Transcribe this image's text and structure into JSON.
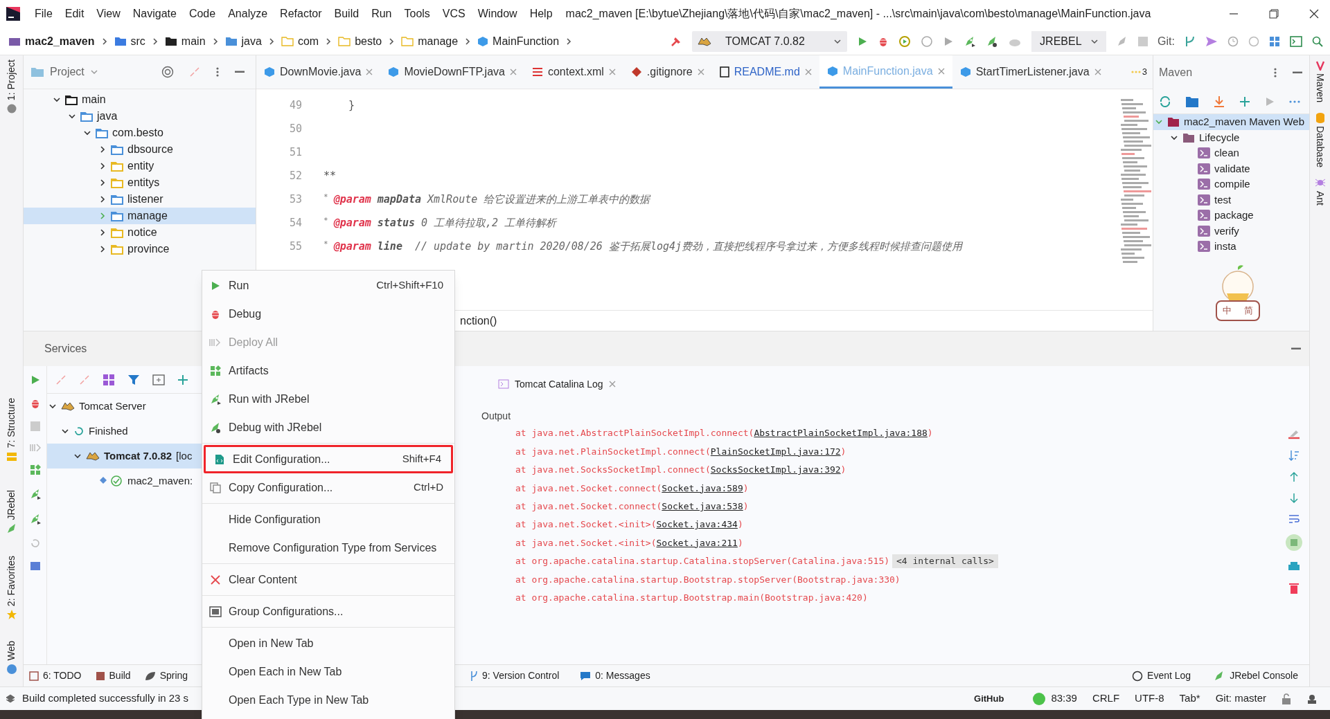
{
  "title_bar": {
    "menus": [
      "File",
      "Edit",
      "View",
      "Navigate",
      "Code",
      "Analyze",
      "Refactor",
      "Build",
      "Run",
      "Tools",
      "VCS",
      "Window",
      "Help"
    ],
    "title": "mac2_maven [E:\\bytue\\Zhejiang\\落地\\代码\\自家\\mac2_maven] - ...\\src\\main\\java\\com\\besto\\manage\\MainFunction.java"
  },
  "breadcrumbs": [
    "mac2_maven",
    "src",
    "main",
    "java",
    "com",
    "besto",
    "manage",
    "MainFunction"
  ],
  "run_config": "TOMCAT 7.0.82",
  "jrebel": "JREBEL",
  "git_label": "Git:",
  "left_stripe": [
    "1: Project",
    "7: Structure",
    "JRebel",
    "2: Favorites",
    "Web"
  ],
  "right_stripe": [
    "Maven",
    "Database",
    "Ant"
  ],
  "project": {
    "title": "Project",
    "tree": [
      {
        "label": "main",
        "color": "#1f1f1f",
        "expanded": true,
        "children": [
          {
            "label": "java",
            "color": "#4a90d9",
            "expanded": true,
            "children": [
              {
                "label": "com.besto",
                "color": "#4a90d9",
                "expanded": true,
                "children": [
                  {
                    "label": "dbsource",
                    "color": "#4a90d9",
                    "expanded": false,
                    "selected": false
                  },
                  {
                    "label": "entity",
                    "color": "#e8b923",
                    "expanded": false,
                    "selected": false
                  },
                  {
                    "label": "entitys",
                    "color": "#e8b923",
                    "expanded": false,
                    "selected": false
                  },
                  {
                    "label": "listener",
                    "color": "#4a90d9",
                    "expanded": false,
                    "selected": false
                  },
                  {
                    "label": "manage",
                    "color": "#4a90d9",
                    "expanded": false,
                    "selected": true
                  },
                  {
                    "label": "notice",
                    "color": "#e8b923",
                    "expanded": false,
                    "selected": false
                  },
                  {
                    "label": "province",
                    "color": "#e8b923",
                    "expanded": false,
                    "selected": false
                  }
                ]
              }
            ]
          }
        ]
      }
    ]
  },
  "editor": {
    "tabs": [
      {
        "label": "DownMovie.java",
        "selected": false,
        "modified": false
      },
      {
        "label": "MovieDownFTP.java",
        "selected": false,
        "modified": false
      },
      {
        "label": "context.xml",
        "selected": false,
        "modified": false
      },
      {
        "label": ".gitignore",
        "selected": false,
        "modified": false
      },
      {
        "label": "README.md",
        "selected": false,
        "modified": true
      },
      {
        "label": "MainFunction.java",
        "selected": true,
        "modified": true
      },
      {
        "label": "StartTimerListener.java",
        "selected": false,
        "modified": false
      }
    ],
    "overflow": "3",
    "lines": [
      {
        "number": "49",
        "code": "    }"
      },
      {
        "number": "50"
      },
      {
        "number": "51"
      },
      {
        "number": "52",
        "code": "**"
      },
      {
        "number": "53",
        "star": "*",
        "tag": "@param",
        "name": "mapData",
        "comment": "XmlRoute 给它设置进来的上游工单表中的数据"
      },
      {
        "number": "54",
        "star": "*",
        "tag": "@param",
        "name": "status",
        "comment": "0 工单待拉取,2 工单待解析"
      },
      {
        "number": "55",
        "star": "*",
        "tag": "@param",
        "name": "line",
        "comment": " // update by martin 2020/08/26 鉴于拓展log4j费劲，直接把线程序号拿过来，方便多线程时候排查问题使用"
      }
    ],
    "breadcrumb": "nction()"
  },
  "maven": {
    "title": "Maven",
    "tree": [
      {
        "label": "mac2_maven Maven Web",
        "expanded": true,
        "selected": true,
        "children": [
          {
            "label": "Lifecycle",
            "expanded": true,
            "selected": false,
            "children": [
              {
                "label": "clean"
              },
              {
                "label": "validate"
              },
              {
                "label": "compile"
              },
              {
                "label": "test"
              },
              {
                "label": "package"
              },
              {
                "label": "verify"
              },
              {
                "label": "insta"
              }
            ]
          }
        ]
      }
    ]
  },
  "ime_badge": {
    "labels": [
      "中",
      "简"
    ]
  },
  "services": {
    "title": "Services",
    "tree": [
      {
        "label": "Tomcat Server",
        "expanded": true,
        "selected": false,
        "children": [
          {
            "label": "Finished",
            "expanded": true,
            "selected": false,
            "children": [
              {
                "label": "Tomcat 7.0.82",
                "suffix": "[loc",
                "expanded": true,
                "selected": true,
                "children": [
                  {
                    "label": "mac2_maven:",
                    "selected": false
                  }
                ]
              }
            ]
          }
        ]
      }
    ],
    "console": {
      "tab": "Tomcat Catalina Log",
      "output_label": "Output",
      "log": [
        {
          "text": "at java.net.AbstractPlainSocketImpl.connect(",
          "link": "AbstractPlainSocketImpl.java:188",
          "suffix": ")"
        },
        {
          "text": "at java.net.PlainSocketImpl.connect(",
          "link": "PlainSocketImpl.java:172",
          "suffix": ")"
        },
        {
          "text": "at java.net.SocksSocketImpl.connect(",
          "link": "SocksSocketImpl.java:392",
          "suffix": ")"
        },
        {
          "text": "at java.net.Socket.connect(",
          "link": "Socket.java:589",
          "suffix": ")"
        },
        {
          "text": "at java.net.Socket.connect(",
          "link": "Socket.java:538",
          "suffix": ")"
        },
        {
          "text": "at java.net.Socket.<init>(",
          "link": "Socket.java:434",
          "suffix": ")"
        },
        {
          "text": "at java.net.Socket.<init>(",
          "link": "Socket.java:211",
          "suffix": ")"
        },
        {
          "text": "at org.apache.catalina.startup.Catalina.stopServer(Catalina.java:515)",
          "badge": "<4 internal calls>"
        },
        {
          "text": "at org.apache.catalina.startup.Bootstrap.stopServer(Bootstrap.java:330)"
        },
        {
          "text": "at org.apache.catalina.startup.Bootstrap.main(Bootstrap.java:420)"
        }
      ]
    }
  },
  "context_menu": {
    "groups": [
      [
        {
          "label": "Run",
          "shortcut": "Ctrl+Shift+F10",
          "disabled": false,
          "annotated": false
        },
        {
          "label": "Debug",
          "disabled": false,
          "annotated": false
        },
        {
          "label": "Deploy All",
          "disabled": true,
          "annotated": false
        },
        {
          "label": "Artifacts",
          "disabled": false,
          "annotated": false
        },
        {
          "label": "Run with JRebel",
          "disabled": false,
          "annotated": false
        },
        {
          "label": "Debug with JRebel",
          "disabled": false,
          "annotated": false
        }
      ],
      [
        {
          "label": "Edit Configuration...",
          "shortcut": "Shift+F4",
          "disabled": false,
          "annotated": true
        },
        {
          "label": "Copy Configuration...",
          "shortcut": "Ctrl+D",
          "disabled": false,
          "annotated": false
        }
      ],
      [
        {
          "label": "Hide Configuration",
          "disabled": false,
          "annotated": false
        },
        {
          "label": "Remove Configuration Type from Services",
          "disabled": false,
          "annotated": false
        }
      ],
      [
        {
          "label": "Clear Content",
          "disabled": false,
          "annotated": false
        }
      ],
      [
        {
          "label": "Group Configurations...",
          "disabled": false,
          "annotated": false
        }
      ],
      [
        {
          "label": "Open in New Tab",
          "disabled": false,
          "annotated": false
        },
        {
          "label": "Open Each in New Tab",
          "disabled": false,
          "annotated": false
        },
        {
          "label": "Open Each Type in New Tab",
          "disabled": false,
          "annotated": false
        }
      ]
    ]
  },
  "bottom_tools": {
    "left": [
      "6: TODO",
      "Build",
      "Spring"
    ],
    "middle": [
      "9: Version Control",
      "0: Messages"
    ],
    "right": [
      "Event Log",
      "JRebel Console"
    ]
  },
  "status_bar": {
    "message": "Build completed successfully in 23 s",
    "github": "GitHub",
    "position": "83:39",
    "line_separator": "CRLF",
    "encoding": "UTF-8",
    "indent": "Tab*",
    "branch": "Git: master"
  }
}
